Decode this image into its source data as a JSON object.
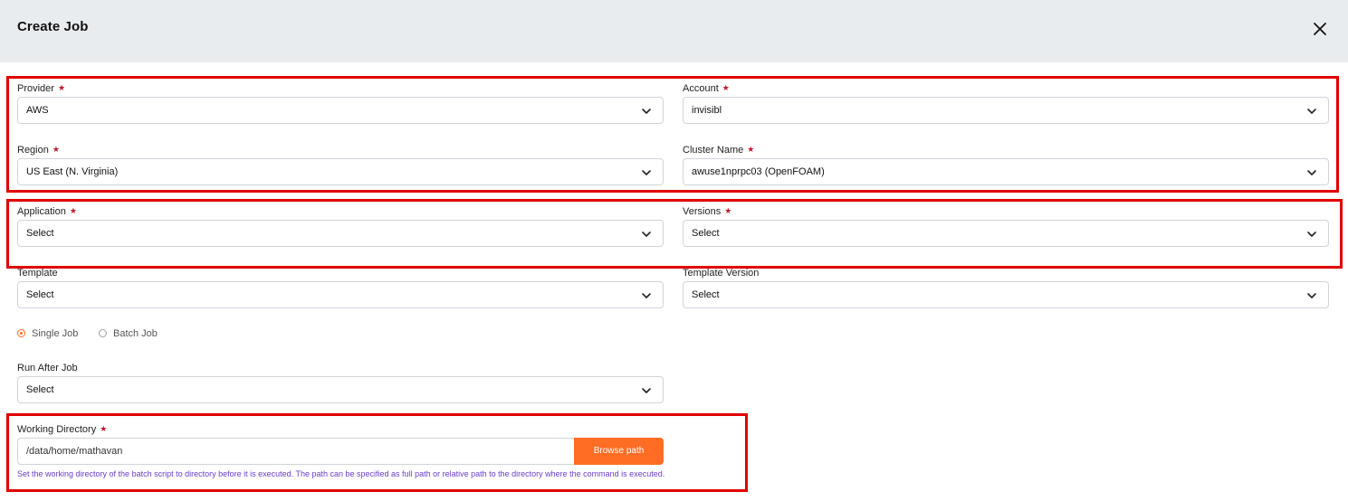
{
  "header": {
    "title": "Create Job"
  },
  "required_marker": "★",
  "fields": {
    "provider": {
      "label": "Provider",
      "value": "AWS"
    },
    "account": {
      "label": "Account",
      "value": "invisibl"
    },
    "region": {
      "label": "Region",
      "value": "US East (N. Virginia)"
    },
    "cluster": {
      "label": "Cluster Name",
      "value": "awuse1nprpc03 (OpenFOAM)"
    },
    "application": {
      "label": "Application",
      "value": "Select"
    },
    "versions": {
      "label": "Versions",
      "value": "Select"
    },
    "template": {
      "label": "Template",
      "value": "Select"
    },
    "template_version": {
      "label": "Template Version",
      "value": "Select"
    },
    "run_after": {
      "label": "Run After Job",
      "value": "Select"
    }
  },
  "job_type": {
    "options": [
      "Single Job",
      "Batch Job"
    ],
    "selected": "Single Job"
  },
  "working_directory": {
    "label": "Working Directory",
    "value": "/data/home/mathavan",
    "button": "Browse path",
    "help": "Set the working directory of the batch script to directory before it is executed. The path can be specified as full path or relative path to the directory where the command is executed."
  },
  "colors": {
    "header_bg": "#e9ecef",
    "accent": "#ff6d24",
    "required": "#c0182c",
    "highlight": "#e00000",
    "help_text": "#6a3fc8"
  }
}
